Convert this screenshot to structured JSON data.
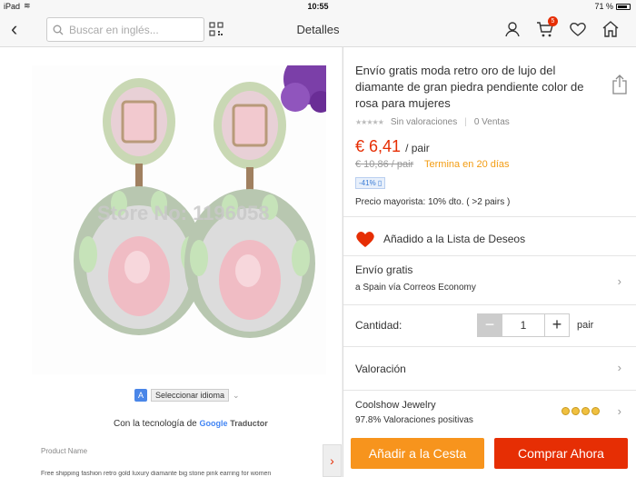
{
  "status_bar": {
    "carrier": "iPad",
    "time": "10:55",
    "battery": "71 %"
  },
  "nav": {
    "back_icon": "back-chevron-icon",
    "search_placeholder": "Buscar en inglés...",
    "title": "Detalles",
    "cart_badge": "5"
  },
  "gallery": {
    "watermark": "Store No: 1196058",
    "translate_button": "Seleccionar idioma",
    "powered_by": "Con la tecnología de",
    "powered_google": "Google",
    "powered_translator": "Traductor",
    "product_name_label": "Product Name",
    "product_name_text": "Free shipping fashion retro gold luxury diamante big stone pink earring for women"
  },
  "product": {
    "title": "Envío gratis moda retro oro de lujo del diamante de gran piedra pendiente color de rosa para mujeres",
    "rating_text": "Sin valoraciones",
    "orders": "0 Ventas",
    "price": "€ 6,41",
    "price_unit": "/ pair",
    "old_price": "€ 10,86 / pair",
    "ends_in": "Termina en 20 días",
    "discount": "-41%",
    "wholesale": "Precio mayorista: 10% dto. ( >2 pairs )"
  },
  "wishlist": {
    "label": "Añadido a la Lista de Deseos"
  },
  "shipping": {
    "title": "Envío gratis",
    "subtitle": "a Spain vía Correos Economy"
  },
  "quantity": {
    "label": "Cantidad:",
    "value": "1",
    "unit": "pair"
  },
  "valuation": {
    "label": "Valoración"
  },
  "seller": {
    "name": "Coolshow Jewelry",
    "feedback": "97.8% Valoraciones positivas"
  },
  "actions": {
    "add_to_cart": "Añadir a la Cesta",
    "buy_now": "Comprar Ahora"
  },
  "colors": {
    "accent": "#e62e04",
    "cart_button": "#f7941d"
  }
}
